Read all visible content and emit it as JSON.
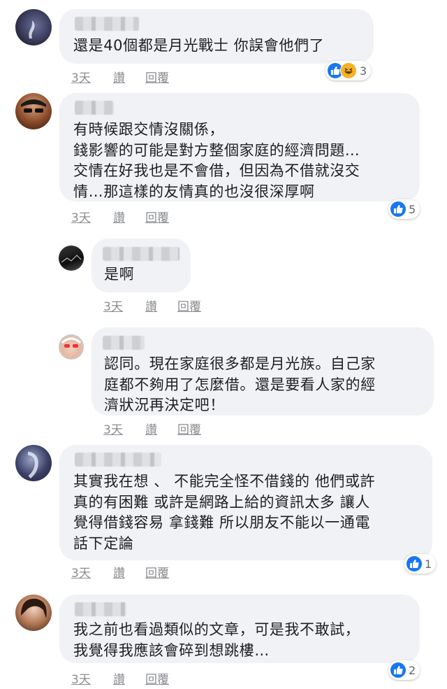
{
  "comments": [
    {
      "text": "還是40個都是月光戰士 你誤會他們了",
      "time": "3天",
      "like_label": "讚",
      "reply_label": "回覆",
      "reaction_count": "3",
      "reactions": [
        "like-icon",
        "haha-icon"
      ]
    },
    {
      "text": "有時候跟交情沒關係，\n錢影響的可能是對方整個家庭的經濟問題…\n交情在好我也是不會借，但因為不借就沒交\n情…那這樣的友情真的也沒很深厚啊",
      "time": "3天",
      "like_label": "讚",
      "reply_label": "回覆",
      "reaction_count": "5",
      "reactions": [
        "like-icon"
      ]
    },
    {
      "text": "是啊",
      "time": "3天",
      "like_label": "讚",
      "reply_label": "回覆"
    },
    {
      "text": "認同。現在家庭很多都是月光族。自己家\n庭都不夠用了怎麼借。還是要看人家的經\n濟狀況再決定吧！",
      "time": "3天",
      "like_label": "讚",
      "reply_label": "回覆"
    },
    {
      "text": "其實我在想 、 不能完全怪不借錢的 他們或許\n真的有困難 或許是網路上給的資訊太多 讓人\n覺得借錢容易 拿錢難 所以朋友不能以一通電\n話下定論",
      "time": "3天",
      "like_label": "讚",
      "reply_label": "回覆",
      "reaction_count": "1",
      "reactions": [
        "like-icon"
      ]
    },
    {
      "text": "我之前也看過類似的文章，可是我不敢試，\n我覺得我應該會碎到想跳樓…",
      "time": "3天",
      "like_label": "讚",
      "reply_label": "回覆",
      "reaction_count": "2",
      "reactions": [
        "like-icon"
      ]
    }
  ],
  "colors": {
    "bubble": "#f0f2f5",
    "like": "#1877f2",
    "meta": "#8a8d91"
  }
}
